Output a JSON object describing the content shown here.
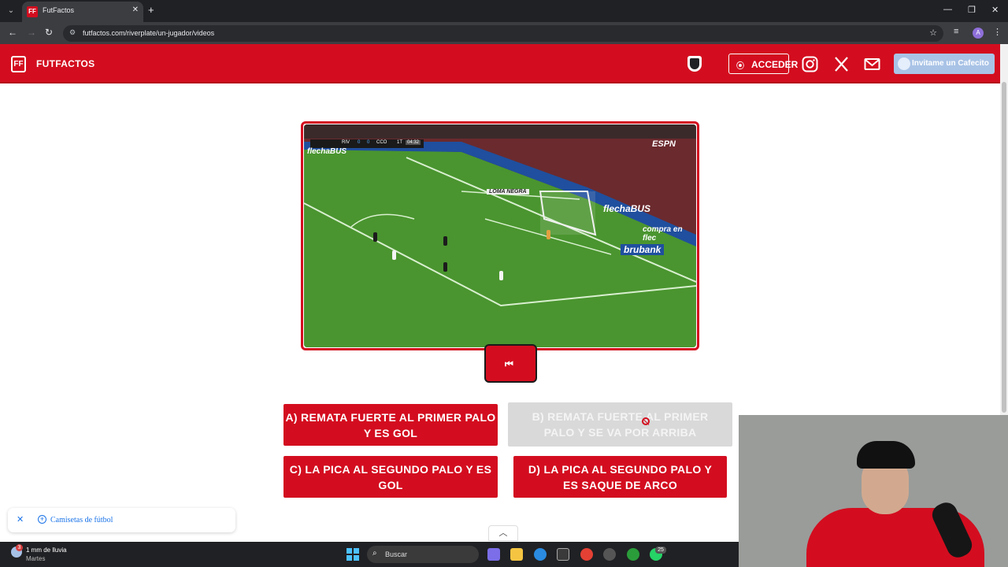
{
  "browser": {
    "tab_title": "FutFactos",
    "url": "futfactos.com/riverplate/un-jugador/videos",
    "profile_initial": "A"
  },
  "header": {
    "brand": "FUTFACTOS",
    "logo_text": "FF",
    "login_label": "ACCEDER",
    "cafecito_label": "Invitame un Cafecito"
  },
  "video": {
    "scoreboard": {
      "home": "RIV",
      "home_score": "0",
      "away_score": "0",
      "away": "CCO",
      "period": "1T",
      "clock": "04:32"
    },
    "broadcaster": "ESPN",
    "ads": [
      "flechaBUS",
      "flechaBUS",
      "compra en flec",
      "brubank",
      "LOMA NEGRA"
    ]
  },
  "answers": [
    {
      "label": "A) REMATA FUERTE AL PRIMER PALO Y ES GOL",
      "enabled": true
    },
    {
      "label": "B) REMATA FUERTE AL PRIMER PALO Y SE VA POR ARRIBA",
      "enabled": false
    },
    {
      "label": "C) LA PICA AL SEGUNDO PALO Y ES GOL",
      "enabled": true
    },
    {
      "label": "D) LA PICA AL SEGUNDO PALO Y ES SAQUE DE ARCO",
      "enabled": true
    }
  ],
  "search_suggestion": "Camisetas de fútbol",
  "taskbar": {
    "weather_temp": "1 mm de lluvia",
    "weather_day": "Martes",
    "weather_badge": "3",
    "search_label": "Buscar",
    "notif_badge": "25"
  },
  "colors": {
    "brand_red": "#d30d1f",
    "disabled_gray": "#d9d9d9",
    "pitch_green": "#3f8a2a"
  }
}
